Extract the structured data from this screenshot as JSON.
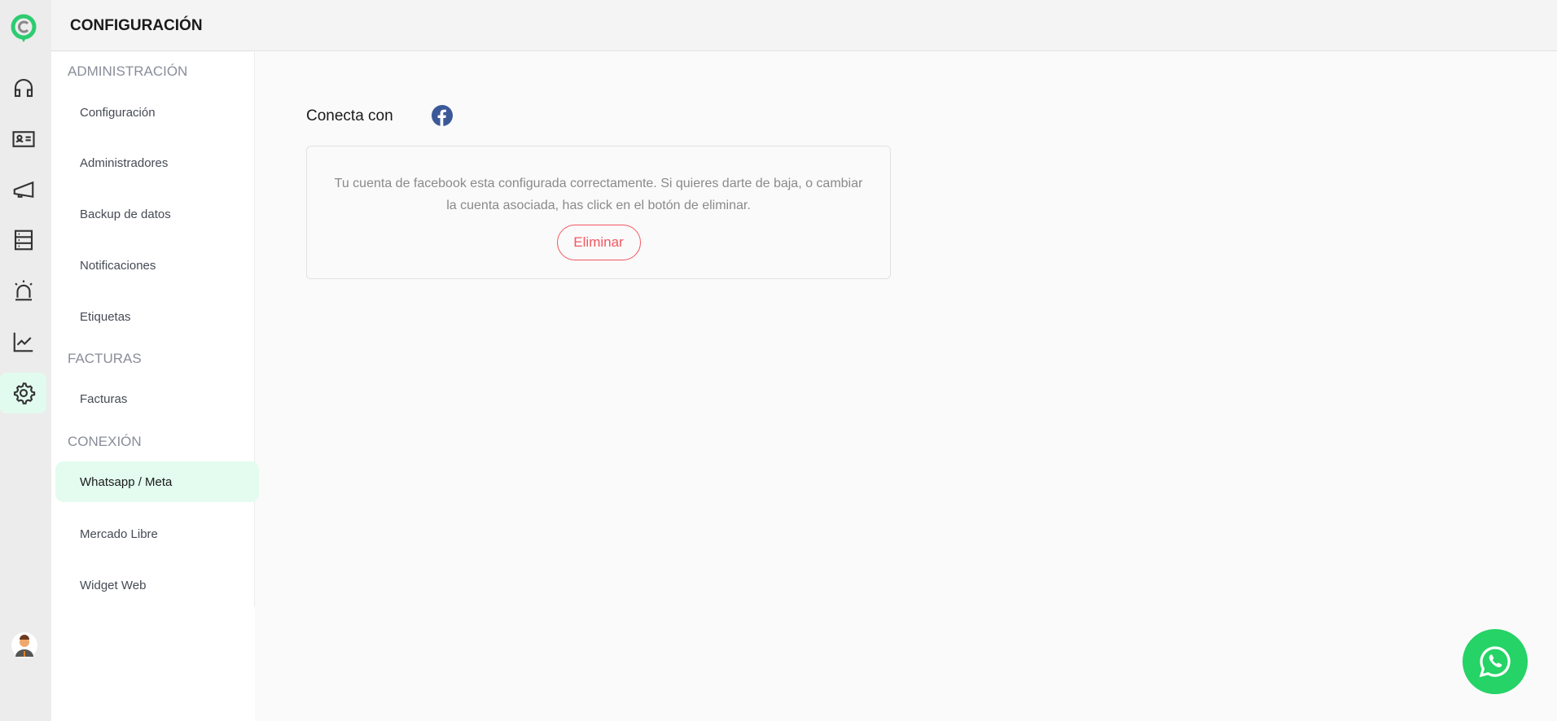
{
  "header": {
    "title": "CONFIGURACIÓN"
  },
  "rail": {
    "items": [
      "headset-icon",
      "contact-card-icon",
      "megaphone-icon",
      "database-icon",
      "alarm-icon",
      "chart-line-icon",
      "gear-icon"
    ],
    "active": "gear-icon"
  },
  "sidebar": {
    "sections": [
      {
        "title": "ADMINISTRACIÓN",
        "items": [
          "Configuración",
          "Administradores",
          "Backup de datos",
          "Notificaciones",
          "Etiquetas"
        ]
      },
      {
        "title": "FACTURAS",
        "items": [
          "Facturas"
        ]
      },
      {
        "title": "CONEXIÓN",
        "items": [
          "Whatsapp / Meta",
          "Mercado Libre",
          "Widget Web"
        ]
      }
    ],
    "active_item": "Whatsapp / Meta"
  },
  "main": {
    "connect_label": "Conecta con",
    "message": "Tu cuenta de facebook esta configurada correctamente. Si quieres darte de baja, o cambiar la cuenta asociada, has click en el botón de eliminar.",
    "delete_label": "Eliminar"
  },
  "colors": {
    "brand": "#2ecc71",
    "active_bg": "#e3fcef",
    "danger": "#f4565f",
    "facebook": "#3b5998",
    "whatsapp": "#25d366"
  }
}
